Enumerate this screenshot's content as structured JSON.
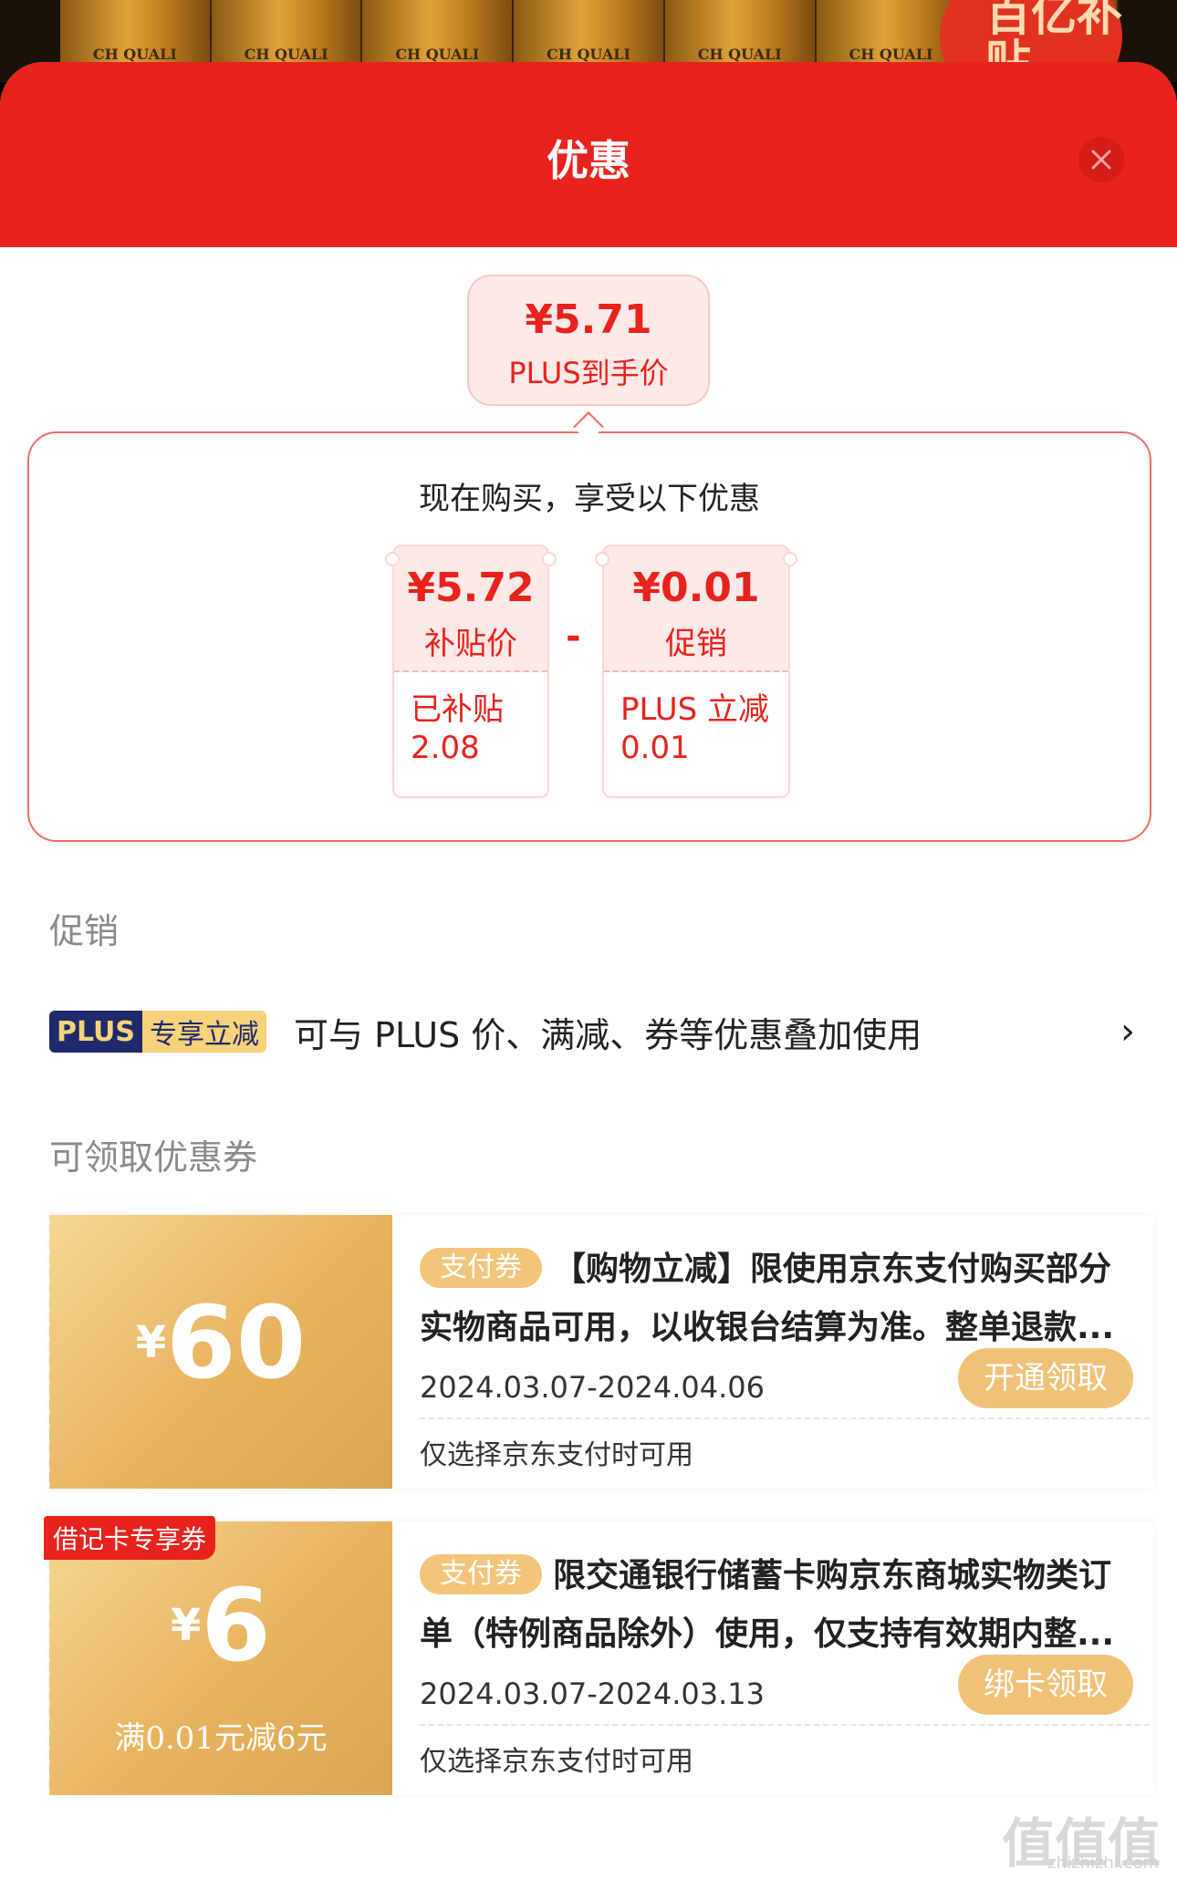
{
  "background": {
    "can_label": "CH QUALI",
    "badge_text": "百亿补贴"
  },
  "sheet": {
    "title": "优惠",
    "close_icon": "close-icon"
  },
  "final_price": {
    "amount": "¥5.71",
    "label": "PLUS到手价"
  },
  "breakdown": {
    "title": "现在购买，享受以下优惠",
    "operator": "-",
    "cards": [
      {
        "value": "¥5.72",
        "label": "补贴价",
        "detail_line1": "已补贴",
        "detail_line2": "2.08"
      },
      {
        "value": "¥0.01",
        "label": "促销",
        "detail_line1": "PLUS 立减",
        "detail_line2": "0.01"
      }
    ]
  },
  "promotion": {
    "section_label": "促销",
    "tag_left": "PLUS",
    "tag_right": "专享立减",
    "text": "可与 PLUS 价、满减、券等优惠叠加使用",
    "chevron": "›"
  },
  "coupons": {
    "section_label": "可领取优惠券",
    "items": [
      {
        "currency": "¥",
        "amount": "60",
        "condition": "",
        "corner_tag": "",
        "pill": "支付券",
        "description": "【购物立减】限使用京东支付购买部分实物商品可用，以收银台结算为准。整单退款...",
        "date_range": "2024.03.07-2024.04.06",
        "note": "仅选择京东支付时可用",
        "button": "开通领取"
      },
      {
        "currency": "¥",
        "amount": "6",
        "condition": "满0.01元减6元",
        "corner_tag": "借记卡专享券",
        "pill": "支付券",
        "description": "限交通银行储蓄卡购京东商城实物类订单（特例商品除外）使用，仅支持有效期内整...",
        "date_range": "2024.03.07-2024.03.13",
        "note": "仅选择京东支付时可用",
        "button": "绑卡领取"
      }
    ]
  },
  "watermark": {
    "text": "值值值",
    "domain": "zhizhizhi.com"
  }
}
